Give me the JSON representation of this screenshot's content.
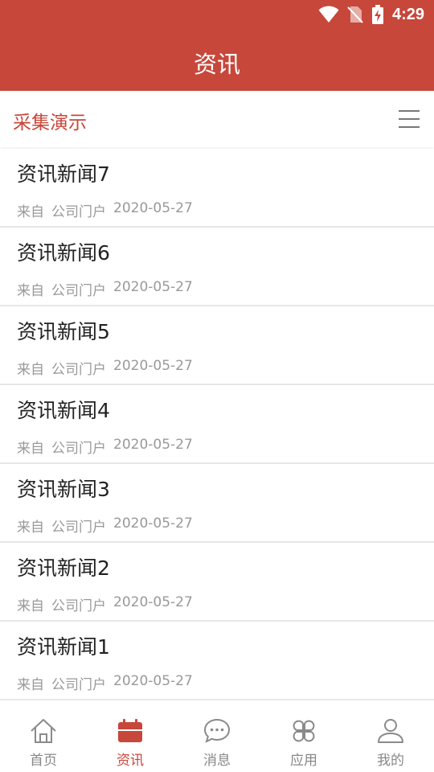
{
  "status_bar": {
    "time": "4:29"
  },
  "header": {
    "title": "资讯"
  },
  "filter": {
    "label": "采集演示"
  },
  "news": [
    {
      "title": "资讯新闻7",
      "from": "来自",
      "source": "公司门户",
      "date": "2020-05-27"
    },
    {
      "title": "资讯新闻6",
      "from": "来自",
      "source": "公司门户",
      "date": "2020-05-27"
    },
    {
      "title": "资讯新闻5",
      "from": "来自",
      "source": "公司门户",
      "date": "2020-05-27"
    },
    {
      "title": "资讯新闻4",
      "from": "来自",
      "source": "公司门户",
      "date": "2020-05-27"
    },
    {
      "title": "资讯新闻3",
      "from": "来自",
      "source": "公司门户",
      "date": "2020-05-27"
    },
    {
      "title": "资讯新闻2",
      "from": "来自",
      "source": "公司门户",
      "date": "2020-05-27"
    },
    {
      "title": "资讯新闻1",
      "from": "来自",
      "source": "公司门户",
      "date": "2020-05-27"
    }
  ],
  "tabs": [
    {
      "label": "首页",
      "icon": "home-icon",
      "active": false
    },
    {
      "label": "资讯",
      "icon": "calendar-icon",
      "active": true
    },
    {
      "label": "消息",
      "icon": "chat-bubble-icon",
      "active": false
    },
    {
      "label": "应用",
      "icon": "apps-clover-icon",
      "active": false
    },
    {
      "label": "我的",
      "icon": "person-icon",
      "active": false
    }
  ],
  "colors": {
    "accent": "#c7473b",
    "muted_text": "#999999",
    "divider": "#e6e6e6"
  }
}
